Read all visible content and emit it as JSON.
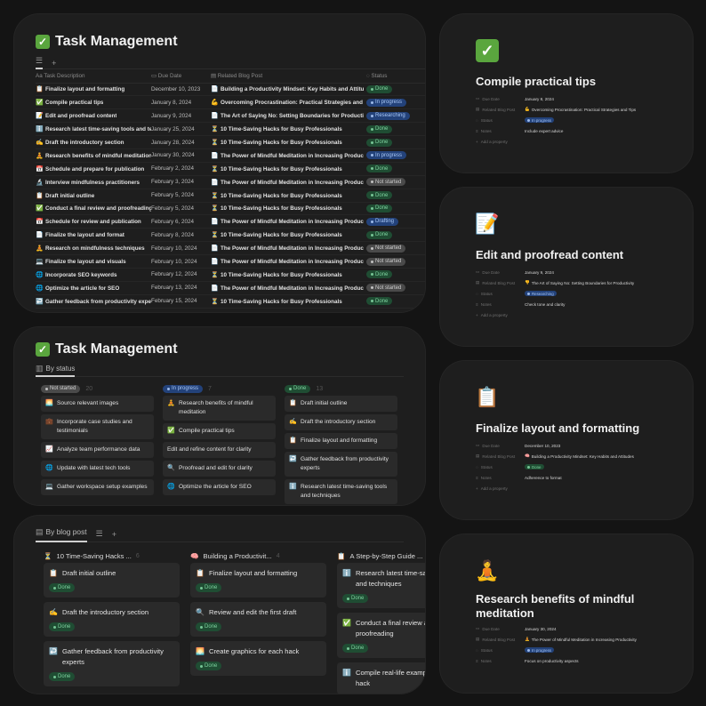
{
  "table_view": {
    "title": "Task Management",
    "tab_icon": "list-icon",
    "columns": [
      "Task Description",
      "Due Date",
      "Related Blog Post",
      "Status"
    ],
    "rows": [
      {
        "icon": "📋",
        "task": "Finalize layout and formatting",
        "date": "December 10, 2023",
        "post_icon": "📄",
        "post": "Building a Productivity Mindset: Key Habits and Attitudes",
        "status": "Done",
        "kind": "done"
      },
      {
        "icon": "✅",
        "task": "Compile practical tips",
        "date": "January 8, 2024",
        "post_icon": "💪",
        "post": "Overcoming Procrastination: Practical Strategies and Tips",
        "status": "In progress",
        "kind": "prog"
      },
      {
        "icon": "📝",
        "task": "Edit and proofread content",
        "date": "January 9, 2024",
        "post_icon": "📄",
        "post": "The Art of Saying No: Setting Boundaries for Productivity",
        "status": "Researching",
        "kind": "prog"
      },
      {
        "icon": "ℹ️",
        "task": "Research latest time-saving tools and techniques",
        "date": "January 25, 2024",
        "post_icon": "⏳",
        "post": "10 Time-Saving Hacks for Busy Professionals",
        "status": "Done",
        "kind": "done"
      },
      {
        "icon": "✍️",
        "task": "Draft the introductory section",
        "date": "January 28, 2024",
        "post_icon": "⏳",
        "post": "10 Time-Saving Hacks for Busy Professionals",
        "status": "Done",
        "kind": "done"
      },
      {
        "icon": "🧘",
        "task": "Research benefits of mindful meditation",
        "date": "January 30, 2024",
        "post_icon": "📄",
        "post": "The Power of Mindful Meditation in Increasing Productivity",
        "status": "In progress",
        "kind": "prog"
      },
      {
        "icon": "📅",
        "task": "Schedule and prepare for publication",
        "date": "February 2, 2024",
        "post_icon": "⏳",
        "post": "10 Time-Saving Hacks for Busy Professionals",
        "status": "Done",
        "kind": "done"
      },
      {
        "icon": "🔬",
        "task": "Interview mindfulness practitioners",
        "date": "February 3, 2024",
        "post_icon": "📄",
        "post": "The Power of Mindful Meditation in Increasing Productivity",
        "status": "Not started",
        "kind": "not"
      },
      {
        "icon": "📋",
        "task": "Draft initial outline",
        "date": "February 5, 2024",
        "post_icon": "⏳",
        "post": "10 Time-Saving Hacks for Busy Professionals",
        "status": "Done",
        "kind": "done"
      },
      {
        "icon": "✅",
        "task": "Conduct a final review and proofreading",
        "date": "February 5, 2024",
        "post_icon": "⏳",
        "post": "10 Time-Saving Hacks for Busy Professionals",
        "status": "Done",
        "kind": "done"
      },
      {
        "icon": "📅",
        "task": "Schedule for review and publication",
        "date": "February 6, 2024",
        "post_icon": "📄",
        "post": "The Power of Mindful Meditation in Increasing Productivity",
        "status": "Drafting",
        "kind": "prog"
      },
      {
        "icon": "📄",
        "task": "Finalize the layout and format",
        "date": "February 8, 2024",
        "post_icon": "⏳",
        "post": "10 Time-Saving Hacks for Busy Professionals",
        "status": "Done",
        "kind": "done"
      },
      {
        "icon": "🧘",
        "task": "Research on mindfulness techniques",
        "date": "February 10, 2024",
        "post_icon": "📄",
        "post": "The Power of Mindful Meditation in Increasing Productivity",
        "status": "Not started",
        "kind": "not"
      },
      {
        "icon": "💻",
        "task": "Finalize the layout and visuals",
        "date": "February 10, 2024",
        "post_icon": "📄",
        "post": "The Power of Mindful Meditation in Increasing Productivity",
        "status": "Not started",
        "kind": "not"
      },
      {
        "icon": "🌐",
        "task": "Incorporate SEO keywords",
        "date": "February 12, 2024",
        "post_icon": "⏳",
        "post": "10 Time-Saving Hacks for Busy Professionals",
        "status": "Done",
        "kind": "done"
      },
      {
        "icon": "🌐",
        "task": "Optimize the article for SEO",
        "date": "February 13, 2024",
        "post_icon": "📄",
        "post": "The Power of Mindful Meditation in Increasing Productivity",
        "status": "Not started",
        "kind": "not"
      },
      {
        "icon": "↩️",
        "task": "Gather feedback from productivity experts",
        "date": "February 15, 2024",
        "post_icon": "⏳",
        "post": "10 Time-Saving Hacks for Busy Professionals",
        "status": "Done",
        "kind": "done"
      }
    ]
  },
  "status_board": {
    "title": "Task Management",
    "tab_label": "By status",
    "columns": [
      {
        "status": "Not started",
        "kind": "not",
        "count": "20",
        "cards": [
          {
            "icon": "🌅",
            "text": "Source relevant images"
          },
          {
            "icon": "💼",
            "text": "Incorporate case studies and testimonials"
          },
          {
            "icon": "📈",
            "text": "Analyze team performance data"
          },
          {
            "icon": "🌐",
            "text": "Update with latest tech tools"
          },
          {
            "icon": "💻",
            "text": "Gather workspace setup examples"
          }
        ]
      },
      {
        "status": "In progress",
        "kind": "prog",
        "count": "7",
        "cards": [
          {
            "icon": "🧘",
            "text": "Research benefits of mindful meditation"
          },
          {
            "icon": "✅",
            "text": "Compile practical tips"
          },
          {
            "icon": "",
            "text": "Edit and refine content for clarity"
          },
          {
            "icon": "🔍",
            "text": "Proofread and edit for clarity"
          },
          {
            "icon": "🌐",
            "text": "Optimize the article for SEO"
          }
        ]
      },
      {
        "status": "Done",
        "kind": "done",
        "count": "13",
        "cards": [
          {
            "icon": "📋",
            "text": "Draft initial outline"
          },
          {
            "icon": "✍️",
            "text": "Draft the introductory section"
          },
          {
            "icon": "📋",
            "text": "Finalize layout and formatting"
          },
          {
            "icon": "↩️",
            "text": "Gather feedback from productivity experts"
          },
          {
            "icon": "ℹ️",
            "text": "Research latest time-saving tools and techniques"
          }
        ]
      }
    ]
  },
  "blog_board": {
    "tab_label": "By blog post",
    "columns": [
      {
        "icon": "⏳",
        "name": "10 Time-Saving Hacks ...",
        "count": "6",
        "cards": [
          {
            "icon": "📋",
            "text": "Draft initial outline",
            "status": "Done"
          },
          {
            "icon": "✍️",
            "text": "Draft the introductory section",
            "status": "Done"
          },
          {
            "icon": "↩️",
            "text": "Gather feedback from productivity experts",
            "status": "Done"
          }
        ]
      },
      {
        "icon": "🧠",
        "name": "Building a Productivit...",
        "count": "4",
        "cards": [
          {
            "icon": "📋",
            "text": "Finalize layout and formatting",
            "status": "Done"
          },
          {
            "icon": "🔍",
            "text": "Review and edit the first draft",
            "status": "Done"
          },
          {
            "icon": "🌅",
            "text": "Create graphics for each hack",
            "status": "Done"
          }
        ]
      },
      {
        "icon": "📋",
        "name": "A Step-by-Step Guide ...",
        "count": "",
        "cards": [
          {
            "icon": "ℹ️",
            "text": "Research latest time-saving tools and techniques",
            "status": "Done"
          },
          {
            "icon": "✅",
            "text": "Conduct a final review and proofreading",
            "status": "Done"
          },
          {
            "icon": "ℹ️",
            "text": "Compile real-life examples for each hack",
            "status": ""
          }
        ]
      }
    ]
  },
  "prop_labels": {
    "due": "Due Date",
    "post": "Related Blog Post",
    "status": "Status",
    "notes": "Notes",
    "add": "Add a property"
  },
  "pages": [
    {
      "icon": "✅",
      "title": "Compile practical tips",
      "due": "January 8, 2024",
      "post_icon": "💪",
      "post": "Overcoming Procrastination: Practical Strategies and Tips",
      "status": "In progress",
      "kind": "prog",
      "notes": "Include expert advice"
    },
    {
      "icon": "📝",
      "title": "Edit and proofread content",
      "due": "January 9, 2024",
      "post_icon": "👎",
      "post": "The Art of Saying No: Setting Boundaries for Productivity",
      "status": "Researching",
      "kind": "prog",
      "notes": "Check tone and clarity"
    },
    {
      "icon": "📋",
      "title": "Finalize layout and formatting",
      "due": "December 10, 2023",
      "post_icon": "🧠",
      "post": "Building a Productivity Mindset: Key Habits and Attitudes",
      "status": "Done",
      "kind": "done",
      "notes": "Adherence to format"
    },
    {
      "icon": "🧘",
      "title": "Research benefits of mindful meditation",
      "due": "January 30, 2024",
      "post_icon": "🧘",
      "post": "The Power of Mindful Meditation in Increasing Productivity",
      "status": "In progress",
      "kind": "prog",
      "notes": "Focus on productivity aspects"
    }
  ]
}
